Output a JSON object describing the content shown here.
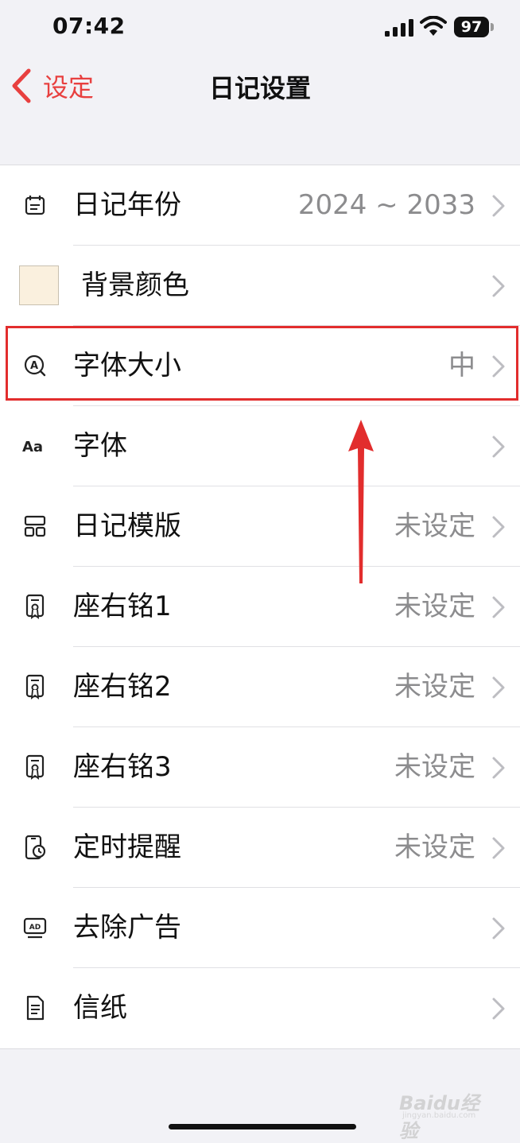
{
  "status": {
    "time": "07:42",
    "battery": "97"
  },
  "nav": {
    "back_label": "设定",
    "title": "日记设置"
  },
  "rows": [
    {
      "label": "日记年份",
      "value": "2024 ~ 2033",
      "icon": "calendar-icon"
    },
    {
      "label": "背景颜色",
      "value": "",
      "icon": "color-swatch",
      "swatch_color": "#faf0de"
    },
    {
      "label": "字体大小",
      "value": "中",
      "icon": "font-size-icon"
    },
    {
      "label": "字体",
      "value": "",
      "icon": "font-icon"
    },
    {
      "label": "日记模版",
      "value": "未设定",
      "icon": "template-icon"
    },
    {
      "label": "座右铭1",
      "value": "未设定",
      "icon": "certificate-icon"
    },
    {
      "label": "座右铭2",
      "value": "未设定",
      "icon": "certificate-icon"
    },
    {
      "label": "座右铭3",
      "value": "未设定",
      "icon": "certificate-icon"
    },
    {
      "label": "定时提醒",
      "value": "未设定",
      "icon": "phone-clock-icon"
    },
    {
      "label": "去除广告",
      "value": "",
      "icon": "ad-icon"
    },
    {
      "label": "信纸",
      "value": "",
      "icon": "document-icon"
    }
  ],
  "annotation": {
    "highlight_color": "#e22d2d",
    "highlighted_row": "字体大小"
  },
  "watermark": {
    "brand": "Baidu经验",
    "url": "jingyan.baidu.com"
  },
  "colors": {
    "accent": "#e8403f",
    "secondary_text": "#8c8c8e",
    "background": "#f2f2f6"
  }
}
